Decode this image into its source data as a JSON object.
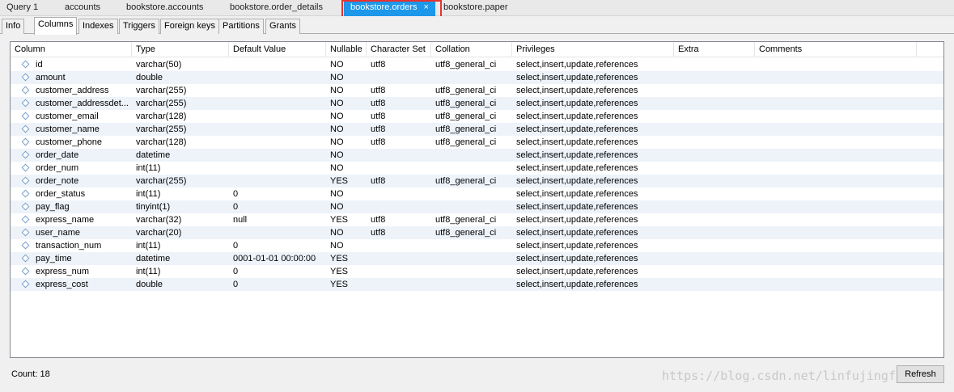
{
  "editor_tabs": [
    "Query 1",
    "accounts",
    "bookstore.accounts",
    "bookstore.order_details",
    "bookstore.orders",
    "bookstore.paper"
  ],
  "close_glyph": "×",
  "sub_tabs": [
    "Info",
    "Columns",
    "Indexes",
    "Triggers",
    "Foreign keys",
    "Partitions",
    "Grants"
  ],
  "grid": {
    "headers": [
      "Column",
      "Type",
      "Default Value",
      "Nullable",
      "Character Set",
      "Collation",
      "Privileges",
      "Extra",
      "Comments"
    ],
    "rows": [
      [
        "id",
        "varchar(50)",
        "",
        "NO",
        "utf8",
        "utf8_general_ci",
        "select,insert,update,references"
      ],
      [
        "amount",
        "double",
        "",
        "NO",
        "",
        "",
        "select,insert,update,references"
      ],
      [
        "customer_address",
        "varchar(255)",
        "",
        "NO",
        "utf8",
        "utf8_general_ci",
        "select,insert,update,references"
      ],
      [
        "customer_addressdet...",
        "varchar(255)",
        "",
        "NO",
        "utf8",
        "utf8_general_ci",
        "select,insert,update,references"
      ],
      [
        "customer_email",
        "varchar(128)",
        "",
        "NO",
        "utf8",
        "utf8_general_ci",
        "select,insert,update,references"
      ],
      [
        "customer_name",
        "varchar(255)",
        "",
        "NO",
        "utf8",
        "utf8_general_ci",
        "select,insert,update,references"
      ],
      [
        "customer_phone",
        "varchar(128)",
        "",
        "NO",
        "utf8",
        "utf8_general_ci",
        "select,insert,update,references"
      ],
      [
        "order_date",
        "datetime",
        "",
        "NO",
        "",
        "",
        "select,insert,update,references"
      ],
      [
        "order_num",
        "int(11)",
        "",
        "NO",
        "",
        "",
        "select,insert,update,references"
      ],
      [
        "order_note",
        "varchar(255)",
        "",
        "YES",
        "utf8",
        "utf8_general_ci",
        "select,insert,update,references"
      ],
      [
        "order_status",
        "int(11)",
        "0",
        "NO",
        "",
        "",
        "select,insert,update,references"
      ],
      [
        "pay_flag",
        "tinyint(1)",
        "0",
        "NO",
        "",
        "",
        "select,insert,update,references"
      ],
      [
        "express_name",
        "varchar(32)",
        "null",
        "YES",
        "utf8",
        "utf8_general_ci",
        "select,insert,update,references"
      ],
      [
        "user_name",
        "varchar(20)",
        "",
        "NO",
        "utf8",
        "utf8_general_ci",
        "select,insert,update,references"
      ],
      [
        "transaction_num",
        "int(11)",
        "0",
        "NO",
        "",
        "",
        "select,insert,update,references"
      ],
      [
        "pay_time",
        "datetime",
        "0001-01-01 00:00:00",
        "YES",
        "",
        "",
        "select,insert,update,references"
      ],
      [
        "express_num",
        "int(11)",
        "0",
        "YES",
        "",
        "",
        "select,insert,update,references"
      ],
      [
        "express_cost",
        "double",
        "0",
        "YES",
        "",
        "",
        "select,insert,update,references"
      ]
    ]
  },
  "footer": {
    "count_text": "Count: 18",
    "refresh_label": "Refresh",
    "watermark": "https://blog.csdn.net/linfujingfu"
  }
}
